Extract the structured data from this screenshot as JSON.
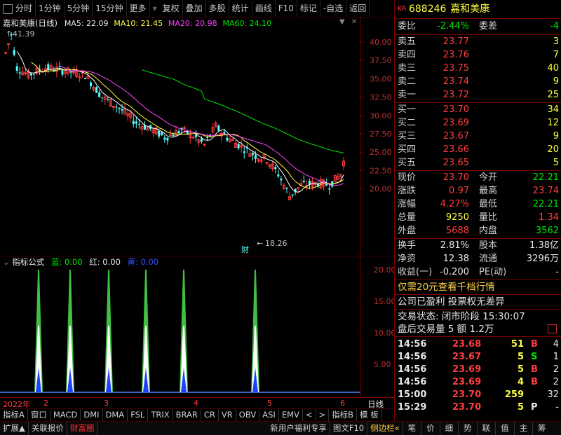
{
  "toolbar": {
    "items": [
      "分时",
      "1分钟",
      "5分钟",
      "15分钟",
      "更多",
      "复权",
      "叠加",
      "多股",
      "统计",
      "画线",
      "F10",
      "标记",
      "-自选",
      "返回"
    ]
  },
  "stock": {
    "code": "688246",
    "name": "嘉和美康",
    "tag": "KR"
  },
  "main_chart": {
    "title": "嘉和美康(日线)",
    "ma5": "MA5: 22.09",
    "ma10": "MA10: 21.45",
    "ma20": "MA20: 20.98",
    "ma60": "MA60: 24.10",
    "high_label": "41.39",
    "low_label": "18.26",
    "cai_label": "财",
    "y_ticks": [
      "40.00",
      "37.50",
      "35.00",
      "32.50",
      "30.00",
      "27.50",
      "25.00",
      "22.50",
      "20.00"
    ],
    "colors": {
      "up": "#ff3c3c",
      "down": "#54ffff",
      "ma5": "#ffffff",
      "ma10": "#ffff40",
      "ma20": "#ff40ff",
      "ma60": "#00e600"
    }
  },
  "indicator": {
    "title": "指标公式",
    "blue_label": "蓝:",
    "blue_value": "0.00",
    "red_label": "红:",
    "red_value": "0.00",
    "navy_label": "黄:",
    "navy_value": "0.00",
    "y_ticks": [
      "20.00",
      "15.00",
      "10.00",
      "5.00"
    ]
  },
  "x_axis": {
    "year": "2022年",
    "months": [
      "2",
      "3",
      "4",
      "5",
      "6"
    ],
    "right_label": "日线"
  },
  "bottom_tabs": [
    "指标A",
    "窗口",
    "MACD",
    "DMI",
    "DMA",
    "FSL",
    "TRIX",
    "BRAR",
    "CR",
    "VR",
    "OBV",
    "ASI",
    "EMV",
    "<",
    ">",
    "指标B",
    "模 板"
  ],
  "bottom_bar": [
    "扩展▲",
    "关联报价",
    "财富圈",
    "新用户福利专享",
    "图文F10",
    "侧边栏«",
    "笔",
    "价",
    "细",
    "势",
    "联",
    "值",
    "主",
    "筹"
  ],
  "panel": {
    "weibi_label": "委比",
    "weibi": "-2.44%",
    "weicha_label": "委差",
    "weicha": "-4",
    "sell": [
      {
        "label": "卖五",
        "price": "23.77",
        "vol": "3"
      },
      {
        "label": "卖四",
        "price": "23.76",
        "vol": "7"
      },
      {
        "label": "卖三",
        "price": "23.75",
        "vol": "40"
      },
      {
        "label": "卖二",
        "price": "23.74",
        "vol": "9"
      },
      {
        "label": "卖一",
        "price": "23.72",
        "vol": "25"
      }
    ],
    "buy": [
      {
        "label": "买一",
        "price": "23.70",
        "vol": "34"
      },
      {
        "label": "买二",
        "price": "23.69",
        "vol": "12"
      },
      {
        "label": "买三",
        "price": "23.67",
        "vol": "9"
      },
      {
        "label": "买四",
        "price": "23.66",
        "vol": "20"
      },
      {
        "label": "买五",
        "price": "23.65",
        "vol": "5"
      }
    ],
    "quote": [
      {
        "l1": "现价",
        "v1": "23.70",
        "l2": "今开",
        "v2": "22.21"
      },
      {
        "l1": "涨跌",
        "v1": "0.97",
        "l2": "最高",
        "v2": "23.74"
      },
      {
        "l1": "涨幅",
        "v1": "4.27%",
        "l2": "最低",
        "v2": "22.21"
      },
      {
        "l1": "总量",
        "v1": "9250",
        "l2": "量比",
        "v2": "1.34"
      },
      {
        "l1": "外盘",
        "v1": "5688",
        "l2": "内盘",
        "v2": "3562"
      }
    ],
    "stats": [
      {
        "l1": "换手",
        "v1": "2.81%",
        "l2": "股本",
        "v2": "1.38亿"
      },
      {
        "l1": "净资",
        "v1": "12.38",
        "l2": "流通",
        "v2": "3296万"
      },
      {
        "l1": "收益(一)",
        "v1": "-0.200",
        "l2": "PE(动)",
        "v2": "-"
      }
    ],
    "promo": "仅需20元查看千档行情",
    "notice": "公司已盈利 投票权无差异",
    "status": "交易状态: 闭市阶段 15:30:07",
    "after": "盘后交易量 5 额 1.2万",
    "ticks": [
      {
        "time": "14:56",
        "price": "23.68",
        "vol": "51",
        "side": "B",
        "n": "4"
      },
      {
        "time": "14:56",
        "price": "23.67",
        "vol": "5",
        "side": "S",
        "n": "1"
      },
      {
        "time": "14:56",
        "price": "23.69",
        "vol": "5",
        "side": "B",
        "n": "2"
      },
      {
        "time": "14:56",
        "price": "23.69",
        "vol": "4",
        "side": "B",
        "n": "2"
      },
      {
        "time": "15:00",
        "price": "23.70",
        "vol": "259",
        "side": "",
        "n": "32"
      },
      {
        "time": "15:29",
        "price": "23.70",
        "vol": "5",
        "side": "P",
        "n": "-"
      }
    ]
  }
}
